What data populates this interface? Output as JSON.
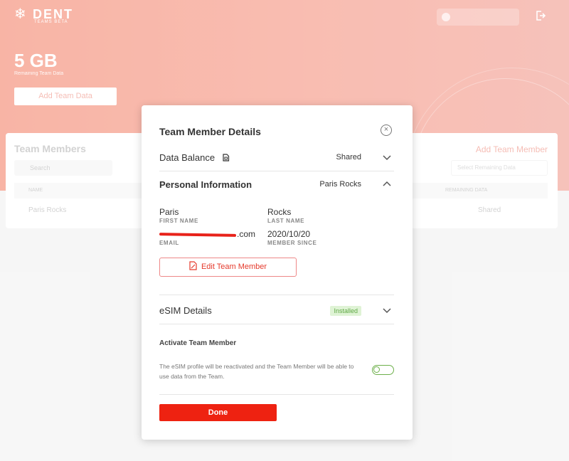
{
  "app": {
    "logo_text": "DENT",
    "logo_subtitle": "TEAMS BETA",
    "data_amount": "5 GB",
    "data_subtitle": "Remaining Team Data",
    "add_team_data_label": "Add Team Data"
  },
  "members": {
    "title": "Team Members",
    "add_member_label": "Add Team Member",
    "search_placeholder": "Search",
    "select_placeholder": "Select Remaining Data",
    "columns": [
      "NAME",
      "REMAINING DATA"
    ],
    "rows": [
      {
        "name": "Paris Rocks",
        "data": "Shared"
      }
    ]
  },
  "modal": {
    "title": "Team Member Details",
    "data_balance": {
      "label": "Data Balance",
      "value": "Shared"
    },
    "personal_info": {
      "label": "Personal Information",
      "value": "Paris Rocks"
    },
    "fields": {
      "first_name": {
        "value": "Paris",
        "label": "FIRST NAME"
      },
      "last_name": {
        "value": "Rocks",
        "label": "LAST NAME"
      },
      "email": {
        "value": ".com",
        "label": "EMAIL"
      },
      "member_since": {
        "value": "2020/10/20",
        "label": "MEMBER SINCE"
      }
    },
    "edit_button_label": "Edit Team Member",
    "esim": {
      "label": "eSIM Details",
      "badge": "Installed"
    },
    "activate": {
      "title": "Activate Team Member",
      "description": "The eSIM profile will be reactivated and the Team Member will be able to use data from the Team.",
      "toggle_on": false
    },
    "done_label": "Done"
  },
  "colors": {
    "accent": "#ee2211",
    "hero": "#f58d76",
    "success": "#6db04a"
  }
}
